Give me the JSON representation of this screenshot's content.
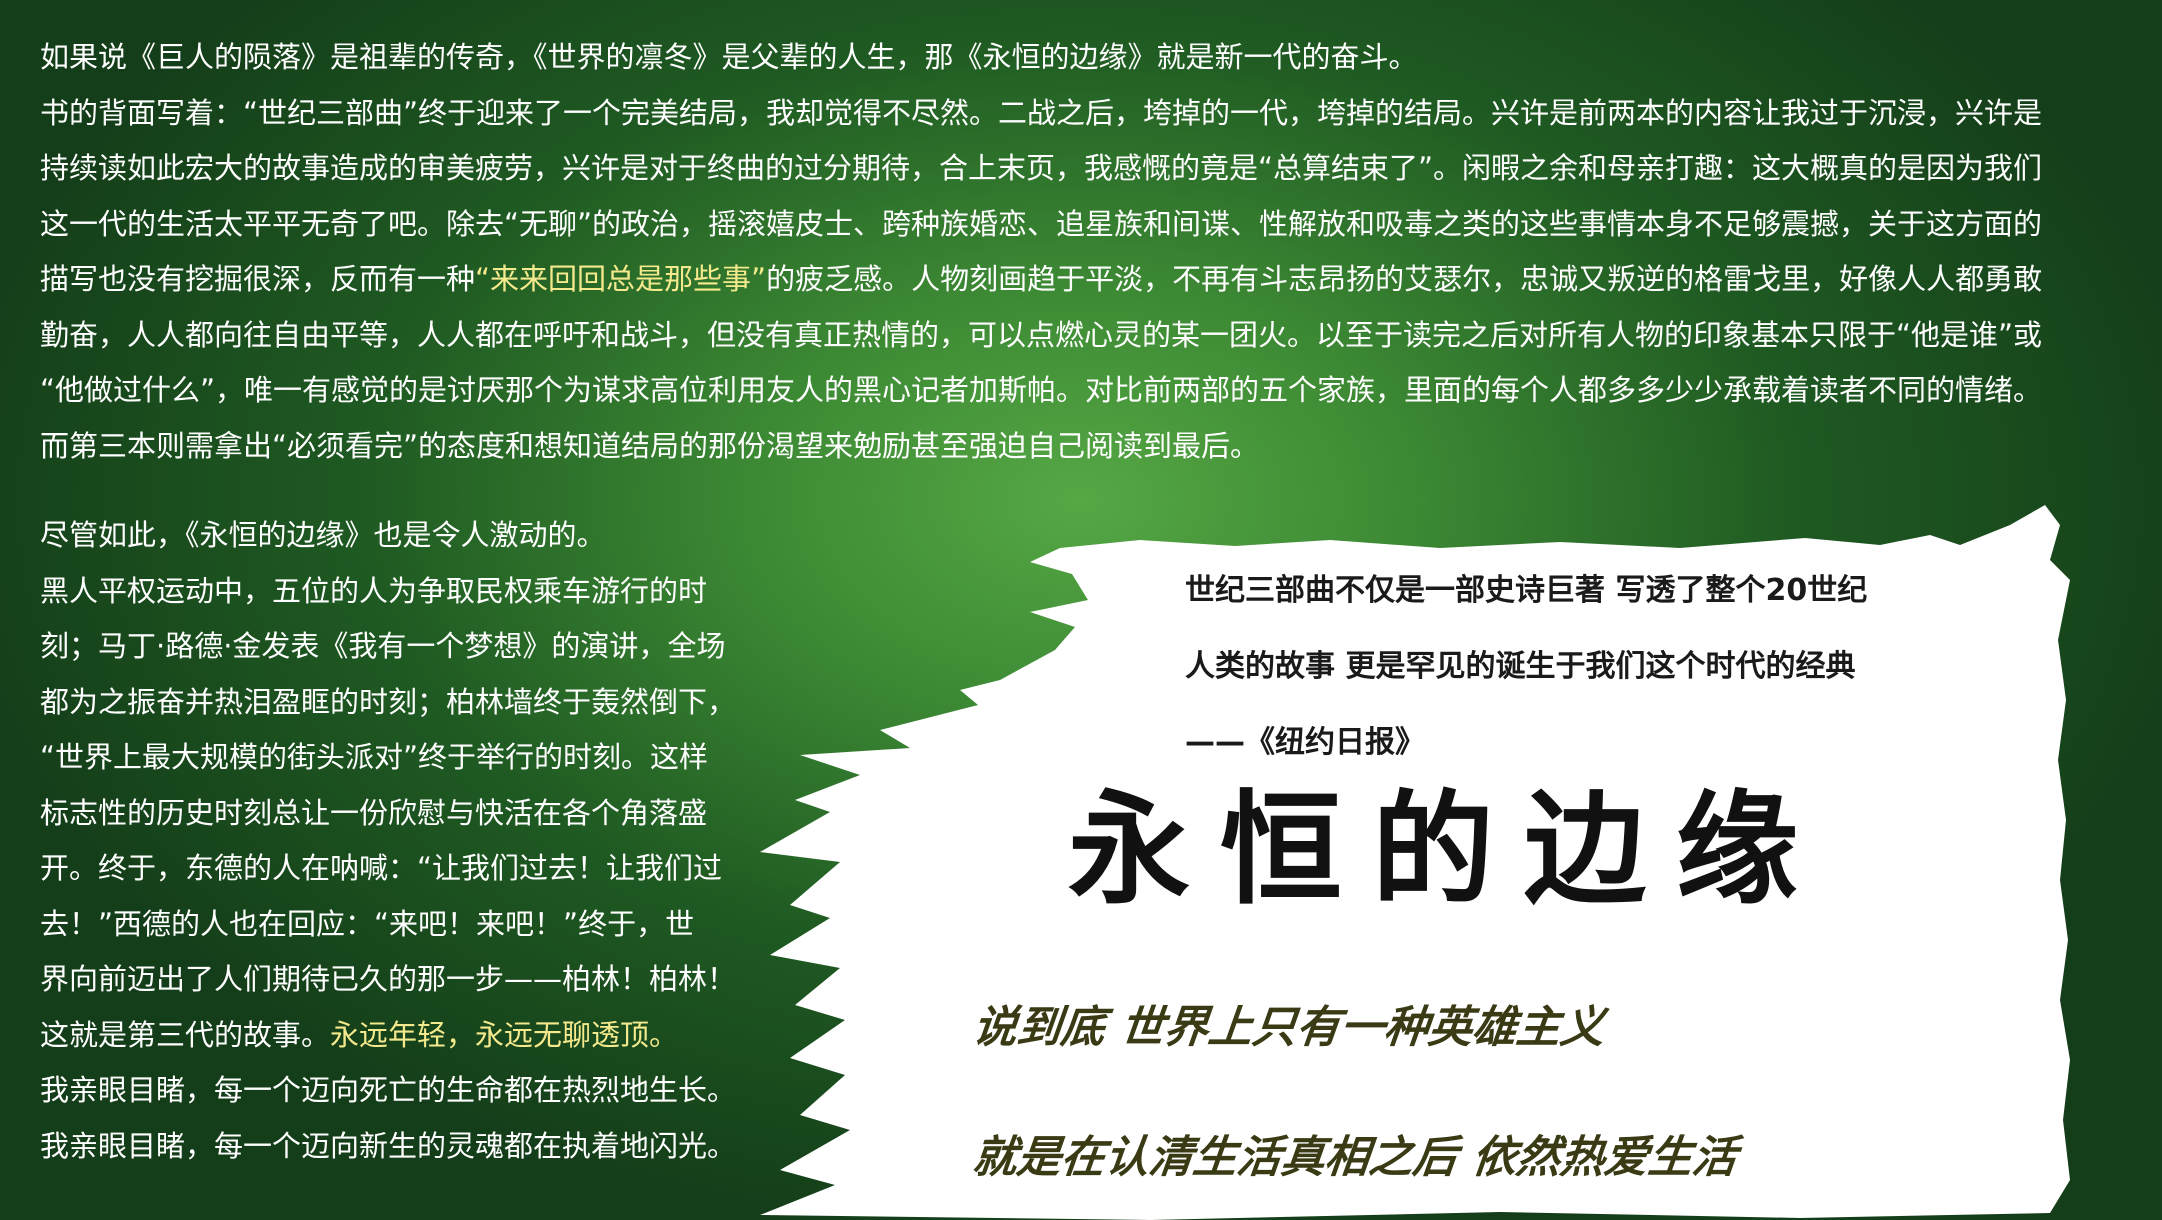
{
  "intro": {
    "line_1": "如果说《巨人的陨落》是祖辈的传奇，《世界的凛冬》是父辈的人生，那《永恒的边缘》就是新一代的奋斗。",
    "line_2": "书的背面写着：“世纪三部曲”终于迎来了一个完美结局，我却觉得不尽然。二战之后，垮掉的一代，垮掉的结局。兴许是前两本的内容让我过于沉浸，兴许是",
    "line_3": "持续读如此宏大的故事造成的审美疲劳，兴许是对于终曲的过分期待，合上末页，我感慨的竟是“总算结束了”。闲暇之余和母亲打趣：这大概真的是因为我们",
    "line_4": "这一代的生活太平平无奇了吧。除去“无聊”的政治，摇滚嬉皮士、跨种族婚恋、追星族和间谍、性解放和吸毒之类的这些事情本身不足够震撼，关于这方面的",
    "line_5_pre": "描写也没有挖掘很深，反而有一种",
    "line_5_highlight": "“来来回回总是那些事”",
    "line_5_post": "的疲乏感。人物刻画趋于平淡，不再有斗志昂扬的艾瑟尔，忠诚又叛逆的格雷戈里，好像人人都勇敢",
    "line_6": "勤奋，人人都向往自由平等，人人都在呼吁和战斗，但没有真正热情的，可以点燃心灵的某一团火。以至于读完之后对所有人物的印象基本只限于“他是谁”或",
    "line_7": "“他做过什么”，唯一有感觉的是讨厌那个为谋求高位利用友人的黑心记者加斯帕。对比前两部的五个家族，里面的每个人都多多少少承载着读者不同的情绪。",
    "line_8": "而第三本则需拿出“必须看完”的态度和想知道结局的那份渴望来勉励甚至强迫自己阅读到最后。"
  },
  "body2": {
    "line_1": "尽管如此，《永恒的边缘》也是令人激动的。",
    "line_2": "黑人平权运动中，五位的人为争取民权乘车游行的时",
    "line_3": "刻；马丁·路德·金发表《我有一个梦想》的演讲，全场",
    "line_4": "都为之振奋并热泪盈眶的时刻；柏林墙终于轰然倒下，",
    "line_5": "“世界上最大规模的街头派对”终于举行的时刻。这样",
    "line_6": "标志性的历史时刻总让一份欣慰与快活在各个角落盛",
    "line_7": "开。终于，东德的人在呐喊：“让我们过去！让我们过",
    "line_8": "去！”西德的人也在回应：“来吧！来吧！”终于，世",
    "line_9": "界向前迈出了人们期待已久的那一步——柏林！柏林！",
    "line_10_pre": "这就是第三代的故事。",
    "line_10_highlight": "永远年轻，永远无聊透顶。",
    "line_11": "我亲眼目睹，每一个迈向死亡的生命都在热烈地生长。",
    "line_12": "我亲眼目睹，每一个迈向新生的灵魂都在执着地闪光。"
  },
  "quote": {
    "line_1": "世纪三部曲不仅是一部史诗巨著 写透了整个20世纪",
    "line_2": "人类的故事 更是罕见的诞生于我们这个时代的经典",
    "source": "——《纽约日报》"
  },
  "title": "永恒的边缘",
  "slogan_1": "说到底 世界上只有一种英雄主义",
  "slogan_2": "就是在认清生活真相之后 依然热爱生活",
  "colors": {
    "background": "#2e7a2e",
    "text": "#ffffff",
    "highlight": "#f4e98c",
    "brush": "#ffffff",
    "title": "#111111",
    "slogan": "#3a3a14"
  }
}
